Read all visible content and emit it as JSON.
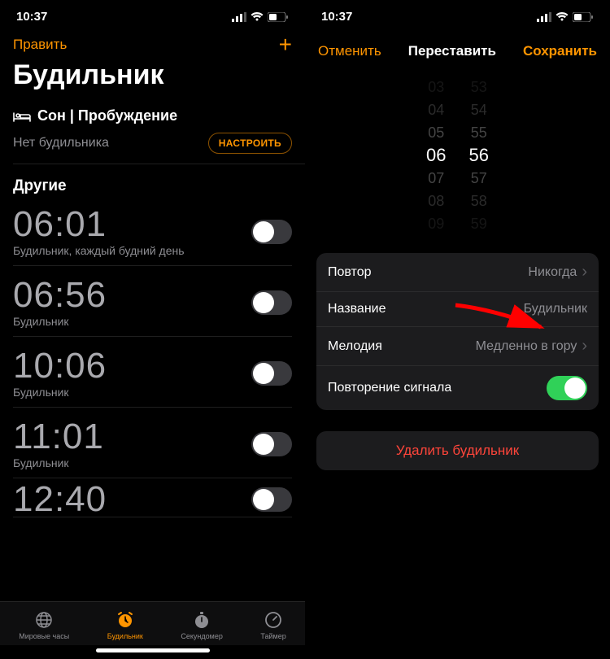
{
  "status": {
    "time": "10:37"
  },
  "left": {
    "edit": "Править",
    "title": "Будильник",
    "sleep_header": "Сон | Пробуждение",
    "no_alarm": "Нет будильника",
    "configure": "НАСТРОИТЬ",
    "other": "Другие",
    "alarms": [
      {
        "time": "06:01",
        "label": "Будильник, каждый будний день",
        "on": false
      },
      {
        "time": "06:56",
        "label": "Будильник",
        "on": false
      },
      {
        "time": "10:06",
        "label": "Будильник",
        "on": false
      },
      {
        "time": "11:01",
        "label": "Будильник",
        "on": false
      },
      {
        "time": "12:40",
        "label": "",
        "on": false
      }
    ],
    "tabs": {
      "world": "Мировые часы",
      "alarm": "Будильник",
      "stopwatch": "Секундомер",
      "timer": "Таймер"
    }
  },
  "right": {
    "cancel": "Отменить",
    "title": "Переставить",
    "save": "Сохранить",
    "picker": {
      "hours": [
        "03",
        "04",
        "05",
        "06",
        "07",
        "08",
        "09"
      ],
      "minutes": [
        "53",
        "54",
        "55",
        "56",
        "57",
        "58",
        "59"
      ],
      "sel_hour": "06",
      "sel_minute": "56"
    },
    "rows": {
      "repeat_label": "Повтор",
      "repeat_value": "Никогда",
      "name_label": "Название",
      "name_value": "Будильник",
      "sound_label": "Мелодия",
      "sound_value": "Медленно в гору",
      "snooze_label": "Повторение сигнала",
      "snooze_on": true
    },
    "delete": "Удалить будильник"
  }
}
